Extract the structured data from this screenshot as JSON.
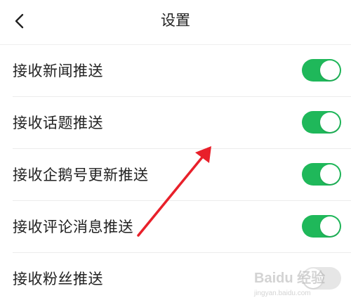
{
  "header": {
    "title": "设置",
    "back_icon": "chevron-left-icon"
  },
  "settings": [
    {
      "label": "接收新闻推送",
      "enabled": true
    },
    {
      "label": "接收话题推送",
      "enabled": true
    },
    {
      "label": "接收企鹅号更新推送",
      "enabled": true
    },
    {
      "label": "接收评论消息推送",
      "enabled": true
    },
    {
      "label": "接收粉丝推送",
      "enabled": false
    }
  ],
  "colors": {
    "toggle_on": "#1fb85a",
    "toggle_off": "#e6e6e6",
    "annotation_arrow": "#e8202a",
    "text": "#222222"
  },
  "watermark": {
    "brand": "Baidu 经验",
    "url": "jingyan.baidu.com"
  }
}
